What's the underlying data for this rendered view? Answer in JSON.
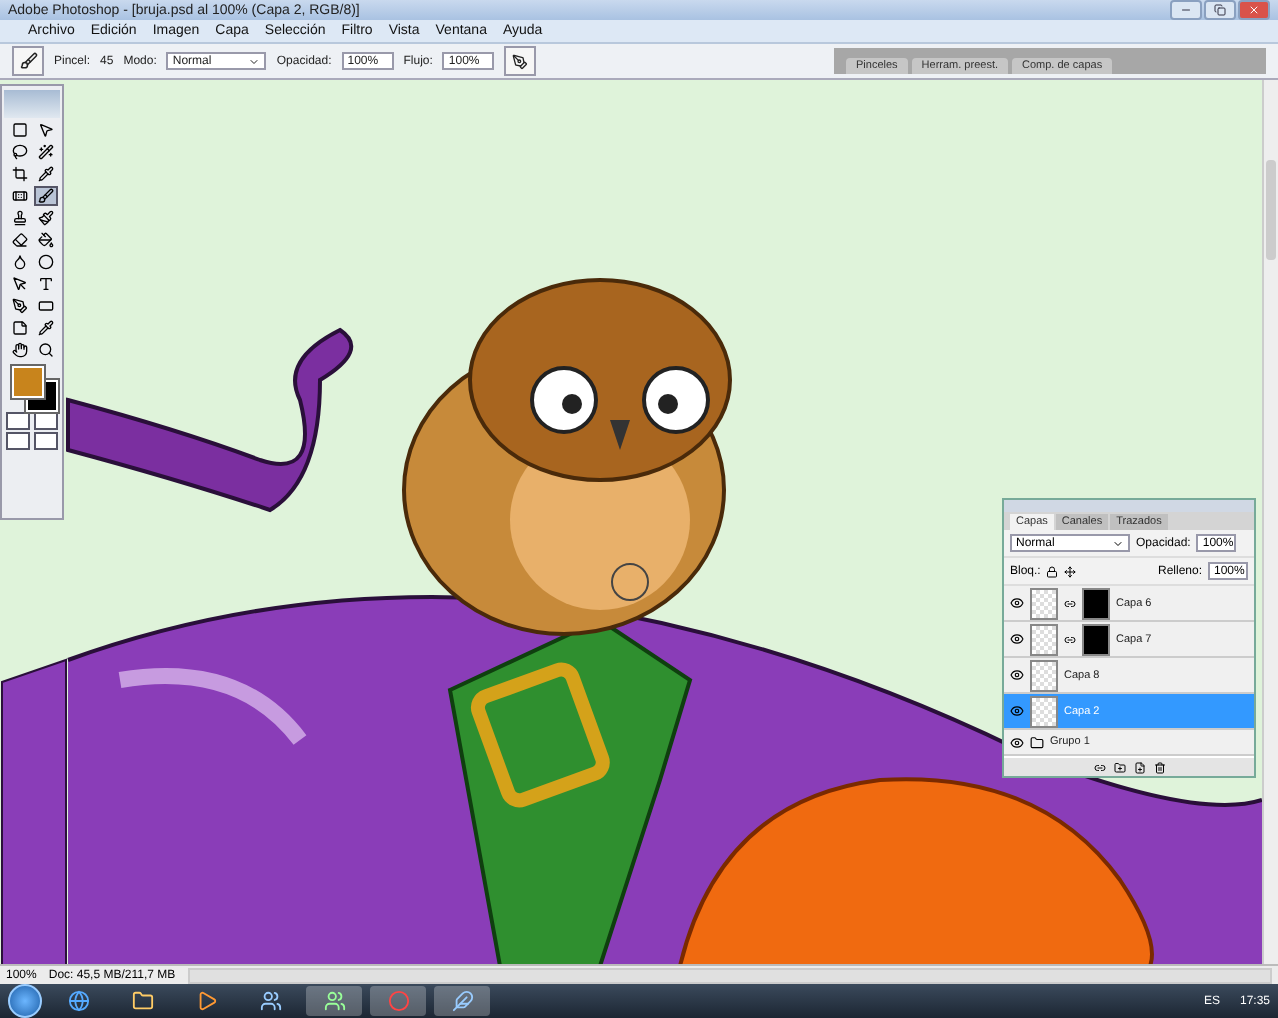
{
  "window": {
    "title": "Adobe Photoshop - [bruja.psd al 100% (Capa 2, RGB/8)]"
  },
  "menu": [
    "Archivo",
    "Edición",
    "Imagen",
    "Capa",
    "Selección",
    "Filtro",
    "Vista",
    "Ventana",
    "Ayuda"
  ],
  "options": {
    "brush_label": "Pincel:",
    "brush_size": "45",
    "mode_label": "Modo:",
    "mode": "Normal",
    "opacity_label": "Opacidad:",
    "opacity": "100%",
    "flow_label": "Flujo:",
    "flow": "100%"
  },
  "palette_well": [
    {
      "label": "Pinceles"
    },
    {
      "label": "Herram. preest."
    },
    {
      "label": "Comp. de capas"
    }
  ],
  "toolbox": {
    "tools": [
      {
        "selected": false
      },
      {
        "selected": false
      },
      {
        "selected": false
      },
      {
        "selected": false
      },
      {
        "selected": false
      },
      {
        "selected": false
      },
      {
        "selected": false
      },
      {
        "selected": true
      },
      {
        "selected": false
      },
      {
        "selected": false
      },
      {
        "selected": false
      },
      {
        "selected": false
      },
      {
        "selected": false
      },
      {
        "selected": false
      },
      {
        "selected": false
      },
      {
        "selected": false
      },
      {
        "selected": false
      },
      {
        "selected": false
      },
      {
        "selected": false
      },
      {
        "selected": false
      },
      {
        "selected": false
      },
      {
        "selected": false
      }
    ],
    "swatches": [
      {
        "color": "#c8841c"
      },
      {
        "color": "#000000"
      }
    ]
  },
  "layers_panel": {
    "tabs": [
      {
        "label": "Capas",
        "selected": true
      },
      {
        "label": "Canales",
        "selected": false
      },
      {
        "label": "Trazados",
        "selected": false
      }
    ],
    "blend_mode": "Normal",
    "opacity_label": "Opacidad:",
    "opacity": "100%",
    "lock_label": "Bloq.:",
    "fill_label": "Relleno:",
    "fill": "100%",
    "layers": [
      {
        "kind": "layer",
        "name": "Capa 6",
        "mask": true,
        "visible": true,
        "selected": false
      },
      {
        "kind": "layer",
        "name": "Capa 7",
        "mask": true,
        "visible": true,
        "selected": false
      },
      {
        "kind": "layer",
        "name": "Capa 8",
        "mask": false,
        "visible": true,
        "selected": false
      },
      {
        "kind": "layer",
        "name": "Capa 2",
        "mask": false,
        "visible": true,
        "selected": true
      },
      {
        "kind": "group",
        "name": "Grupo 1",
        "mask": false,
        "visible": true,
        "selected": false
      }
    ]
  },
  "status_bar": {
    "zoom": "100%",
    "doc": "Doc: 45,5 MB/211,7 MB"
  },
  "taskbar": {
    "language": "ES",
    "time": "17:35"
  }
}
